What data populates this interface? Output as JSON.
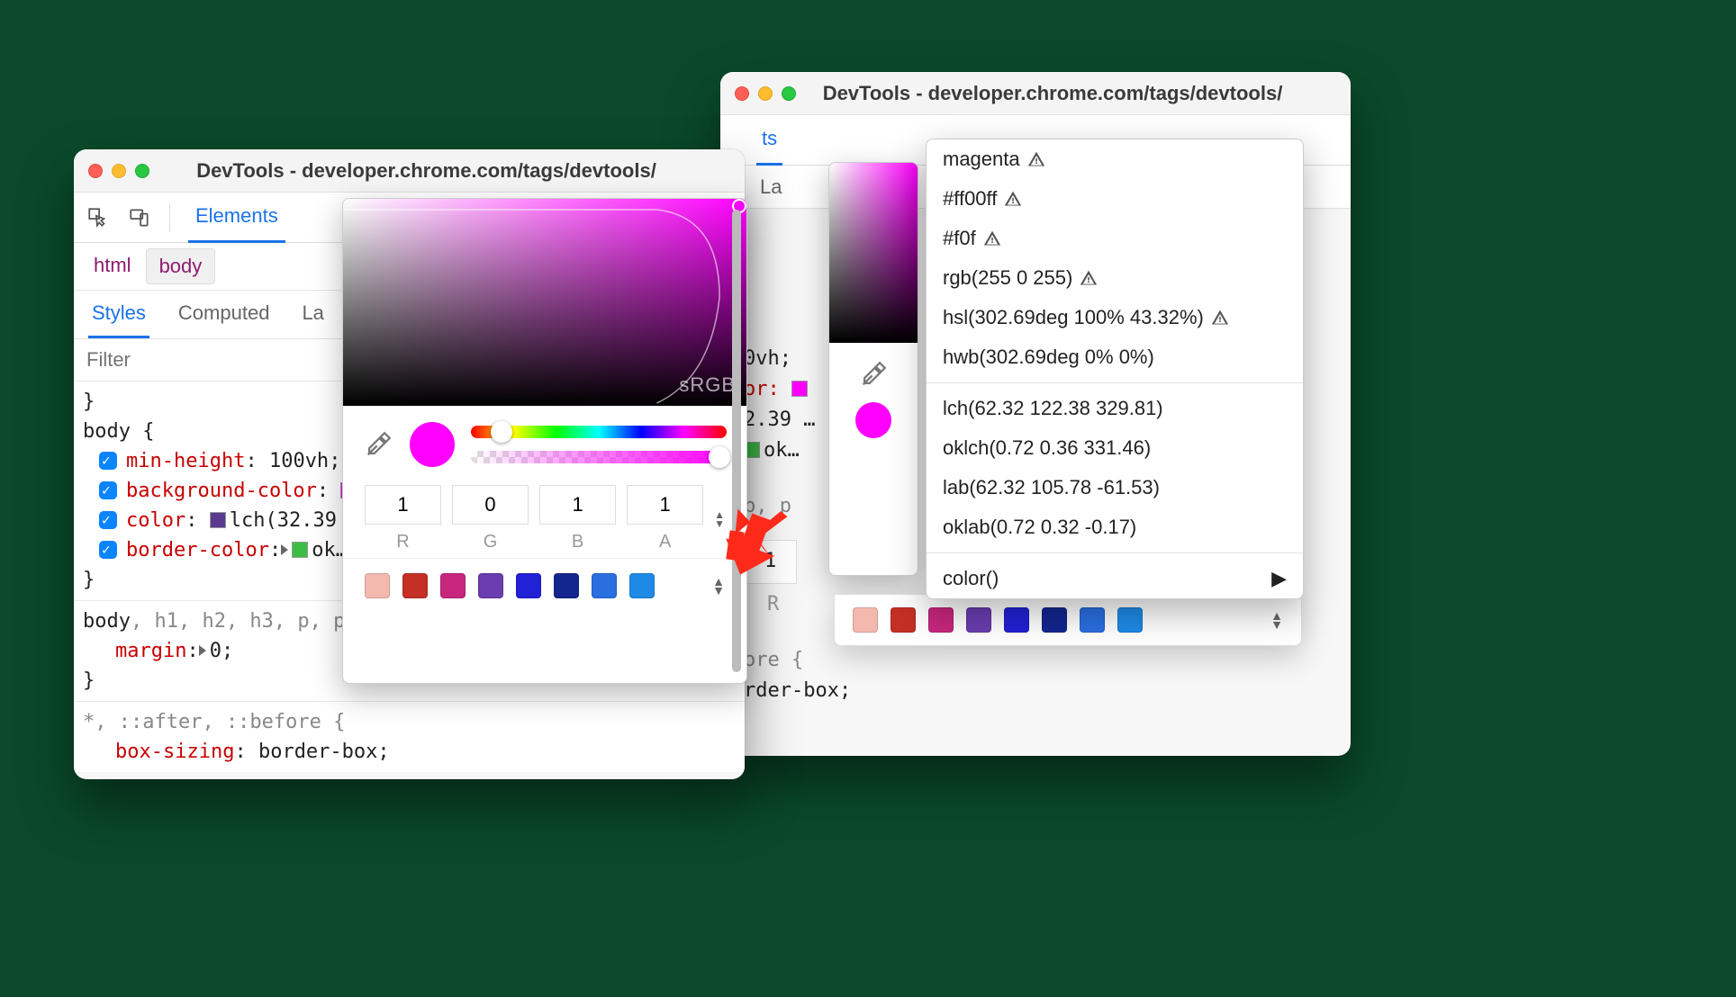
{
  "windows": {
    "title": "DevTools - developer.chrome.com/tags/devtools/"
  },
  "toolbar": {
    "tab_elements": "Elements",
    "tab_short_back": "ts"
  },
  "breadcrumb": {
    "html": "html",
    "body": "body"
  },
  "subtabs": {
    "styles": "Styles",
    "computed": "Computed",
    "layout_trunc": "La",
    "layout_back": "La"
  },
  "filter": {
    "placeholder": "Filter"
  },
  "css": {
    "body_sel": "body",
    "brace_open": " {",
    "brace_close": "}",
    "min_height_prop": "min-height",
    "min_height_val": "100vh",
    "bg_prop": "background-color",
    "color_prop": "color",
    "color_val": "lch(32.39 …",
    "border_prop": "border-color",
    "border_val": "ok…",
    "sel2_gray": "body, h1, h2, h3, p, p",
    "margin_prop": "margin",
    "margin_val": "0",
    "sel3": "*, ::after, ::before {",
    "boxsizing_prop": "box-sizing",
    "boxsizing_val": "border-box",
    "back_vh": "0vh;",
    "back_or": "or:",
    "back_lch": "2.39 …",
    "back_ok": "ok…",
    "back_pp": "p, p",
    "back_R": "R",
    "back_one": "1",
    "back_ore": "ore {",
    "back_rder": "rder-box;"
  },
  "picker": {
    "label_srgb": "sRGB",
    "r": "1",
    "g": "0",
    "b": "1",
    "a": "1",
    "lbl_r": "R",
    "lbl_g": "G",
    "lbl_b": "B",
    "lbl_a": "A"
  },
  "palette": {
    "colors": [
      "#f4b9ae",
      "#c43025",
      "#c7267d",
      "#6a3db0",
      "#2121d6",
      "#13268f",
      "#2a6fe0",
      "#1f8ae6"
    ]
  },
  "menu": {
    "magenta": "magenta",
    "hex6": "#ff00ff",
    "hex3": "#f0f",
    "rgb": "rgb(255 0 255)",
    "hsl": "hsl(302.69deg 100% 43.32%)",
    "hwb": "hwb(302.69deg 0% 0%)",
    "lch": "lch(62.32 122.38 329.81)",
    "oklch": "oklch(0.72 0.36 331.46)",
    "lab": "lab(62.32 105.78 -61.53)",
    "oklab": "oklab(0.72 0.32 -0.17)",
    "colorfn": "color()"
  },
  "swatches": {
    "bg": "#ff00ff",
    "color": "#5a3a8e",
    "border": "#3cbd46"
  }
}
